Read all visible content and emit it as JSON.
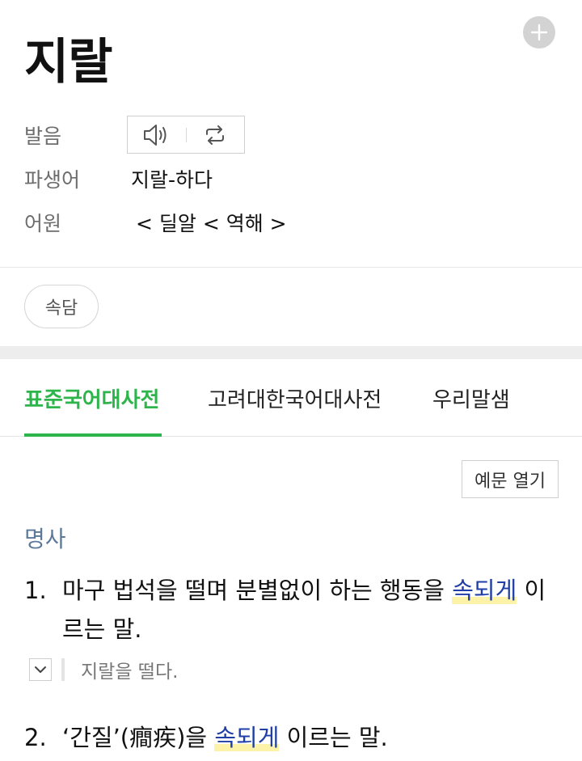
{
  "entry": {
    "headword": "지랄",
    "add_icon": "plus-icon"
  },
  "info": {
    "pronunciation_label": "발음",
    "speaker_icon": "speaker-icon",
    "repeat_icon": "repeat-icon",
    "derivative_label": "파생어",
    "derivative_value": "지랄-하다",
    "etymology_label": "어원",
    "etymology_value": "< 딜알 < 역해 >"
  },
  "chips": {
    "proverb": "속담"
  },
  "tabs": [
    {
      "label": "표준국어대사전",
      "active": true
    },
    {
      "label": "고려대한국어대사전",
      "active": false
    },
    {
      "label": "우리말샘",
      "active": false
    }
  ],
  "colors": {
    "accent_green": "#2db54b",
    "link_blue": "#1f3ea8",
    "highlight_yellow": "#fdf3a8",
    "pos_blue_gray": "#5b7a99"
  },
  "definitions": {
    "example_open_label": "예문 열기",
    "part_of_speech": "명사",
    "senses": [
      {
        "number": "1.",
        "text_before": "마구 법석을 떨며 분별없이 하는 행동을 ",
        "link": "속되게",
        "text_after": " 이르는 말.",
        "example": "지랄을 떨다.",
        "toggle_icon": "chevron-down-icon"
      },
      {
        "number": "2.",
        "text_before": "‘간질’(癎疾)을 ",
        "link": "속되게",
        "text_after": " 이르는 말."
      }
    ]
  }
}
